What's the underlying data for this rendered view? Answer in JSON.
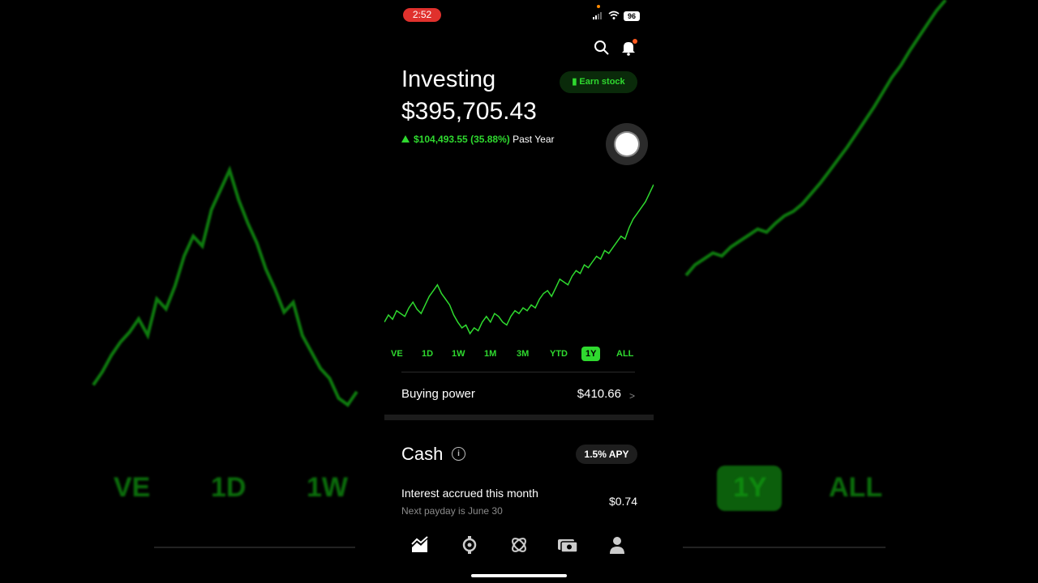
{
  "status_bar": {
    "time": "2:52",
    "battery": "96"
  },
  "header": {
    "search_icon": "search-icon",
    "notification_icon": "bell-icon"
  },
  "portfolio": {
    "title": "Investing",
    "value": "$395,705.43",
    "change": "$104,493.55 (35.88%)",
    "period": "Past Year",
    "earn_label": "Earn stock"
  },
  "timeframes": [
    "LIVE",
    "1D",
    "1W",
    "1M",
    "3M",
    "YTD",
    "1Y",
    "ALL"
  ],
  "timeframe_shown": [
    "VE",
    "1D",
    "1W",
    "1M",
    "3M",
    "YTD",
    "1Y",
    "ALL"
  ],
  "selected_timeframe": "1Y",
  "buying_power": {
    "label": "Buying power",
    "value": "$410.66"
  },
  "cash": {
    "title": "Cash",
    "apy": "1.5% APY",
    "interest_label": "Interest accrued this month",
    "interest_value": "$0.74",
    "payday": "Next payday is June 30"
  },
  "nav": [
    "chart-icon",
    "browse-icon",
    "crypto-icon",
    "cash-icon",
    "account-icon"
  ],
  "colors": {
    "accent": "#2fd92f",
    "background": "#000000",
    "status_red": "#e0312d"
  },
  "chart_data": {
    "type": "line",
    "series": [
      {
        "values": [
          300,
          305,
          302,
          308,
          306,
          304,
          310,
          314,
          309,
          306,
          312,
          318,
          322,
          326,
          320,
          316,
          312,
          305,
          300,
          296,
          298,
          292,
          296,
          294,
          300,
          304,
          300,
          306,
          304,
          300,
          298,
          304,
          308,
          306,
          310,
          308,
          312,
          310,
          316,
          320,
          322,
          318,
          324,
          330,
          328,
          326,
          332,
          336,
          334,
          340,
          338,
          342,
          346,
          344,
          350,
          348,
          352,
          356,
          360,
          358,
          366,
          372,
          376,
          380,
          384,
          390,
          396
        ]
      }
    ]
  },
  "bg_chart": {
    "left": [
      120,
      128,
      138,
      146,
      152,
      160,
      150,
      172,
      166,
      180,
      198,
      210,
      204,
      226,
      238,
      250,
      232,
      218,
      206,
      190,
      178,
      164,
      170,
      150,
      140,
      130,
      124,
      112,
      108,
      116
    ],
    "right": [
      90,
      104,
      112,
      120,
      116,
      128,
      136,
      144,
      152,
      148,
      160,
      170,
      176,
      186,
      200,
      214,
      230,
      246,
      262,
      280,
      298,
      316,
      336,
      356,
      372,
      392,
      410,
      428,
      446,
      460
    ]
  }
}
